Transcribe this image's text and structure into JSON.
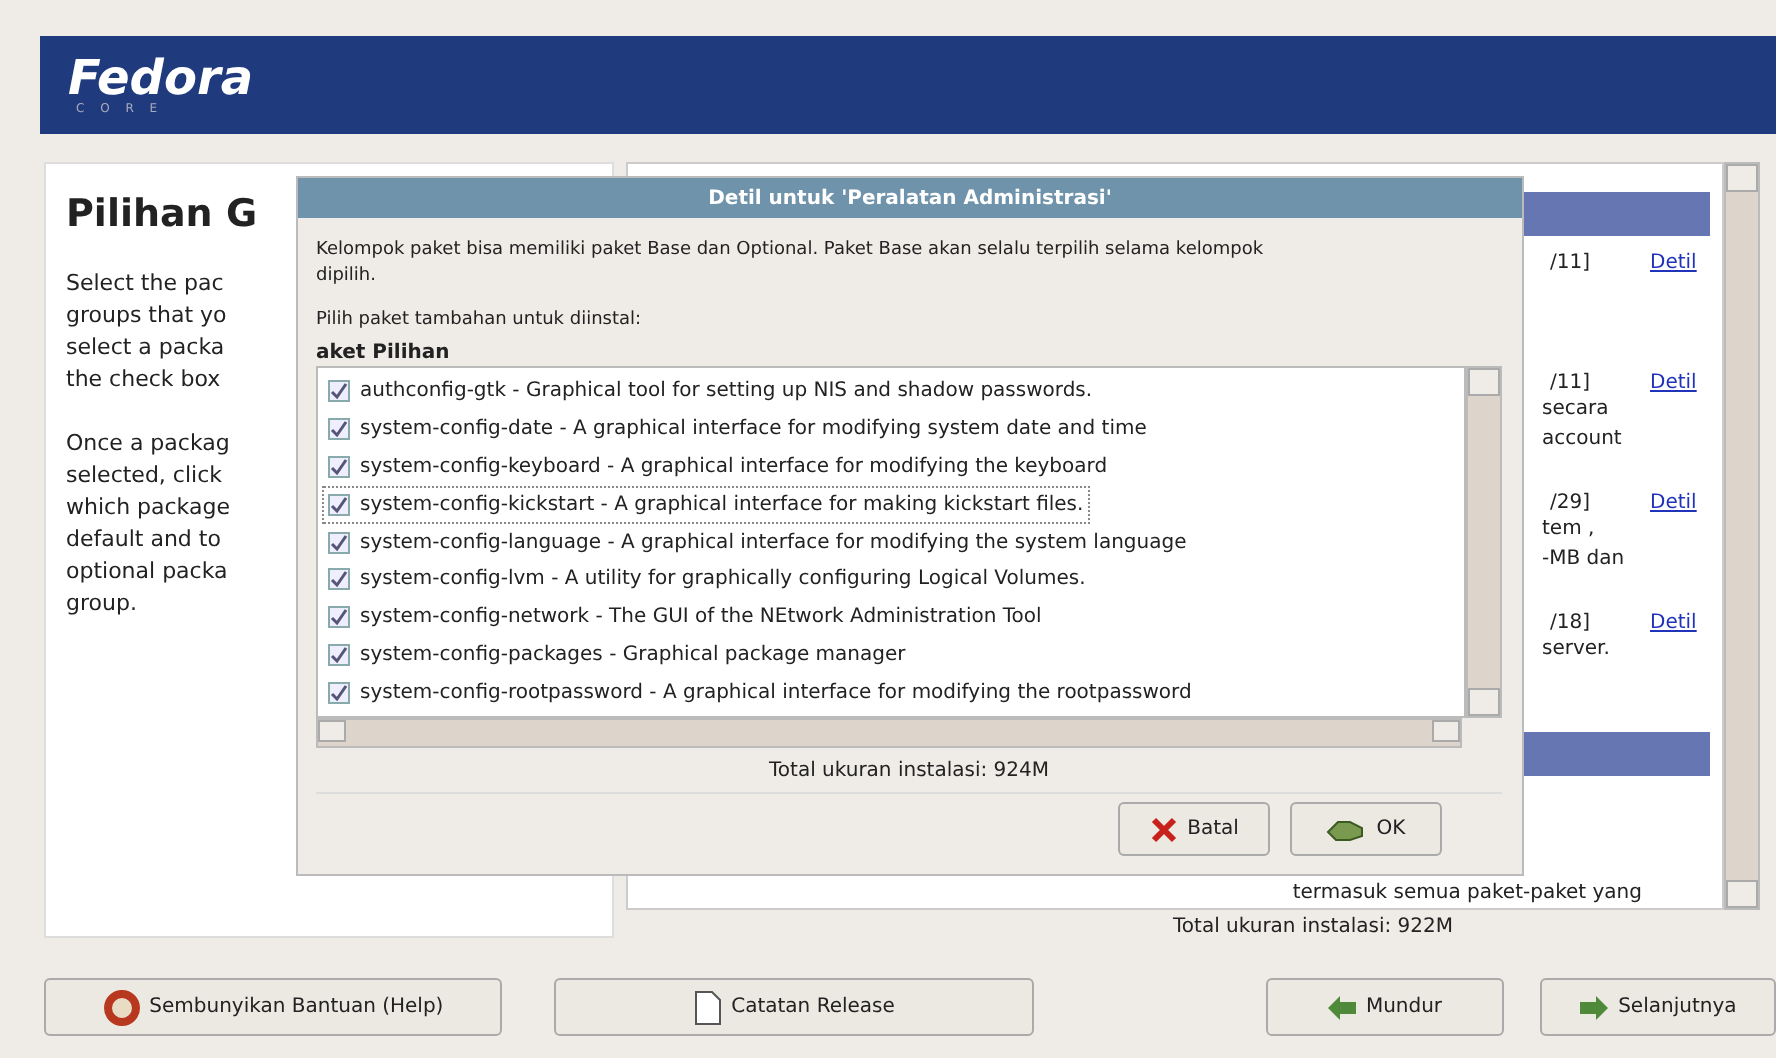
{
  "banner": {
    "logo": "Fedora",
    "sublogo": "C O R E"
  },
  "help": {
    "title": "Pilihan G",
    "paragraphs": [
      [
        "Select the pac",
        "groups that yo",
        "select a packa",
        "the check box"
      ],
      [
        "Once a packag",
        "selected, click",
        "which package",
        "default and to",
        "optional packa",
        "group."
      ]
    ]
  },
  "groups": [
    {
      "kind": "category"
    },
    {
      "kind": "group",
      "count": "/11]",
      "link": "Detil"
    },
    {
      "kind": "group",
      "count": "/11]",
      "link": "Detil",
      "desc": [
        "secara",
        "account"
      ]
    },
    {
      "kind": "group",
      "count": "/29]",
      "link": "Detil",
      "desc": [
        "tem ,",
        "-MB dan"
      ]
    },
    {
      "kind": "group",
      "count": "/18]",
      "link": "Detil",
      "desc": [
        "server."
      ]
    },
    {
      "kind": "category"
    },
    {
      "kind": "note",
      "desc": [
        "termasuk semua paket-paket yang"
      ]
    }
  ],
  "total_main": "Total ukuran instalasi: 922M",
  "dialog": {
    "title": "Detil untuk 'Peralatan Administrasi'",
    "description": "Kelompok paket bisa memiliki paket Base dan Optional. Paket Base akan selalu terpilih selama kelompok dipilih.",
    "prompt": "Pilih paket tambahan untuk diinstal:",
    "list_header": "aket Pilihan",
    "packages": [
      {
        "label": "authconfig-gtk - Graphical tool for setting up NIS and shadow passwords.",
        "checked": true,
        "focused": false
      },
      {
        "label": "system-config-date - A graphical interface for modifying system date and time",
        "checked": true,
        "focused": false
      },
      {
        "label": "system-config-keyboard - A graphical interface for modifying the keyboard",
        "checked": true,
        "focused": false
      },
      {
        "label": "system-config-kickstart - A graphical interface for making kickstart files.",
        "checked": true,
        "focused": true
      },
      {
        "label": "system-config-language - A graphical interface for modifying the system language",
        "checked": true,
        "focused": false
      },
      {
        "label": "system-config-lvm - A utility for graphically configuring Logical Volumes.",
        "checked": true,
        "focused": false
      },
      {
        "label": "system-config-network - The GUI of the NEtwork Administration Tool",
        "checked": true,
        "focused": false
      },
      {
        "label": "system-config-packages - Graphical package manager",
        "checked": true,
        "focused": false
      },
      {
        "label": "system-config-rootpassword - A graphical interface for modifying the rootpassword",
        "checked": true,
        "focused": false
      }
    ],
    "total": "Total ukuran instalasi: 924M",
    "buttons": [
      {
        "kind": "cancel",
        "label": "Batal"
      },
      {
        "kind": "ok",
        "label": "OK"
      }
    ]
  },
  "buttons": [
    {
      "kind": "help",
      "label": "Sembunyikan Bantuan (Help)"
    },
    {
      "kind": "notes",
      "label": "Catatan Release"
    },
    {
      "kind": "back",
      "label": "Mundur"
    },
    {
      "kind": "next",
      "label": "Selanjutnya"
    }
  ]
}
